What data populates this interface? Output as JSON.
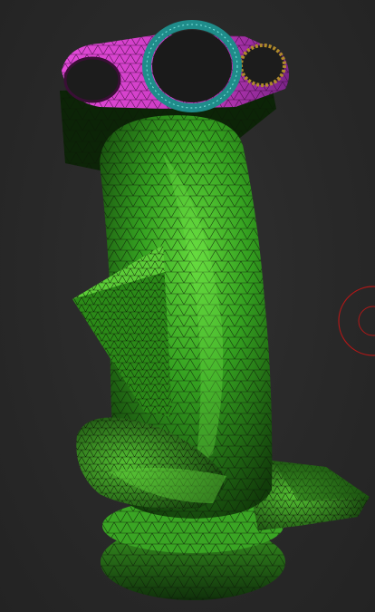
{
  "viewport": {
    "background": "#2b2b2b",
    "model_color": "#2f8f1c",
    "model_highlight": "#5fd63a",
    "wire_color": "#0d1a08",
    "masked_color_a": "#e040d8",
    "masked_color_b": "#8a2a9a",
    "rim_color": "#2aa4a0",
    "brush_cursor_color": "#b01818"
  }
}
